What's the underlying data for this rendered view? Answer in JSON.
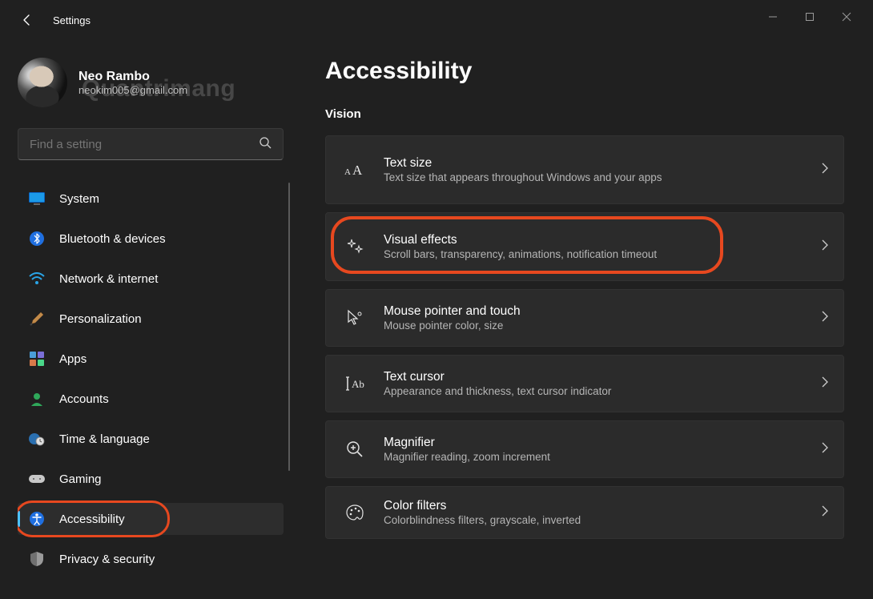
{
  "window": {
    "title": "Settings"
  },
  "profile": {
    "name": "Neo Rambo",
    "email": "neokim005@gmail.com",
    "watermark": "Quantrimang"
  },
  "search": {
    "placeholder": "Find a setting"
  },
  "nav": {
    "items": [
      {
        "label": "System",
        "icon": "monitor",
        "selected": false
      },
      {
        "label": "Bluetooth & devices",
        "icon": "bluetooth",
        "selected": false
      },
      {
        "label": "Network & internet",
        "icon": "wifi",
        "selected": false
      },
      {
        "label": "Personalization",
        "icon": "paintbrush",
        "selected": false
      },
      {
        "label": "Apps",
        "icon": "apps",
        "selected": false
      },
      {
        "label": "Accounts",
        "icon": "person",
        "selected": false
      },
      {
        "label": "Time & language",
        "icon": "clock-globe",
        "selected": false
      },
      {
        "label": "Gaming",
        "icon": "gamepad",
        "selected": false
      },
      {
        "label": "Accessibility",
        "icon": "accessibility",
        "selected": true,
        "highlighted": true
      },
      {
        "label": "Privacy & security",
        "icon": "shield",
        "selected": false
      }
    ]
  },
  "page": {
    "title": "Accessibility",
    "sections": [
      {
        "label": "Vision",
        "items": [
          {
            "title": "Text size",
            "sub": "Text size that appears throughout Windows and your apps",
            "icon": "textsize"
          },
          {
            "title": "Visual effects",
            "sub": "Scroll bars, transparency, animations, notification timeout",
            "icon": "sparkle",
            "highlighted": true
          },
          {
            "title": "Mouse pointer and touch",
            "sub": "Mouse pointer color, size",
            "icon": "cursor"
          },
          {
            "title": "Text cursor",
            "sub": "Appearance and thickness, text cursor indicator",
            "icon": "textcursor"
          },
          {
            "title": "Magnifier",
            "sub": "Magnifier reading, zoom increment",
            "icon": "magnify"
          },
          {
            "title": "Color filters",
            "sub": "Colorblindness filters, grayscale, inverted",
            "icon": "palette"
          }
        ]
      }
    ]
  }
}
